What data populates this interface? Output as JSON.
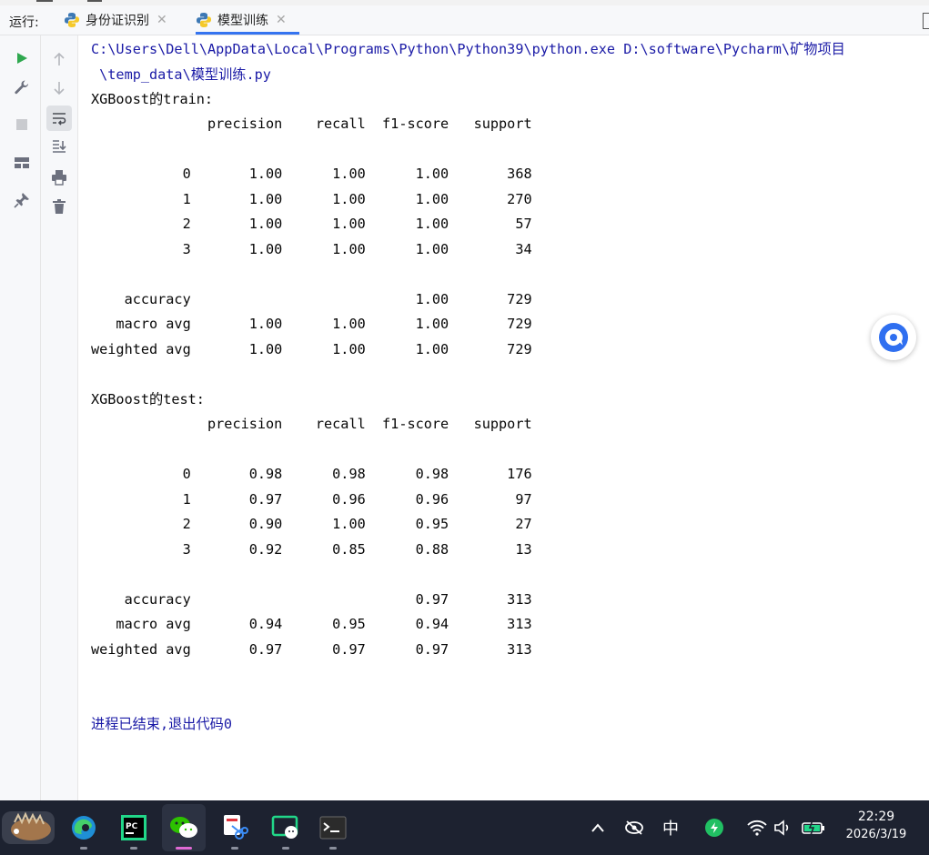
{
  "run_panel": {
    "label": "运行:",
    "tabs": [
      {
        "label": "身份证识别",
        "active": false
      },
      {
        "label": "模型训练",
        "active": true
      }
    ]
  },
  "console": {
    "command": "C:\\Users\\Dell\\AppData\\Local\\Programs\\Python\\Python39\\python.exe D:\\software\\Pycharm\\矿物项目",
    "command_cont": " \\temp_data\\模型训练.py",
    "train_title": "XGBoost的train:",
    "train_header": "              precision    recall  f1-score   support",
    "train_rows": [
      "           0       1.00      1.00      1.00       368",
      "           1       1.00      1.00      1.00       270",
      "           2       1.00      1.00      1.00        57",
      "           3       1.00      1.00      1.00        34"
    ],
    "train_summary": [
      "    accuracy                           1.00       729",
      "   macro avg       1.00      1.00      1.00       729",
      "weighted avg       1.00      1.00      1.00       729"
    ],
    "test_title": "XGBoost的test:",
    "test_header": "              precision    recall  f1-score   support",
    "test_rows": [
      "           0       0.98      0.98      0.98       176",
      "           1       0.97      0.96      0.96        97",
      "           2       0.90      1.00      0.95        27",
      "           3       0.92      0.85      0.88        13"
    ],
    "test_summary": [
      "    accuracy                           0.97       313",
      "   macro avg       0.94      0.95      0.94       313",
      "weighted avg       0.97      0.97      0.97       313"
    ],
    "exit_message": "进程已结束,退出代码0"
  },
  "taskbar": {
    "tray_ime": "中",
    "time": "22:29",
    "date": "2026/3/19"
  },
  "colors": {
    "accent": "#3574f0",
    "console_link": "#1a1aa6",
    "run_green": "#2fa84f",
    "taskbar_bg": "#1d2230"
  }
}
